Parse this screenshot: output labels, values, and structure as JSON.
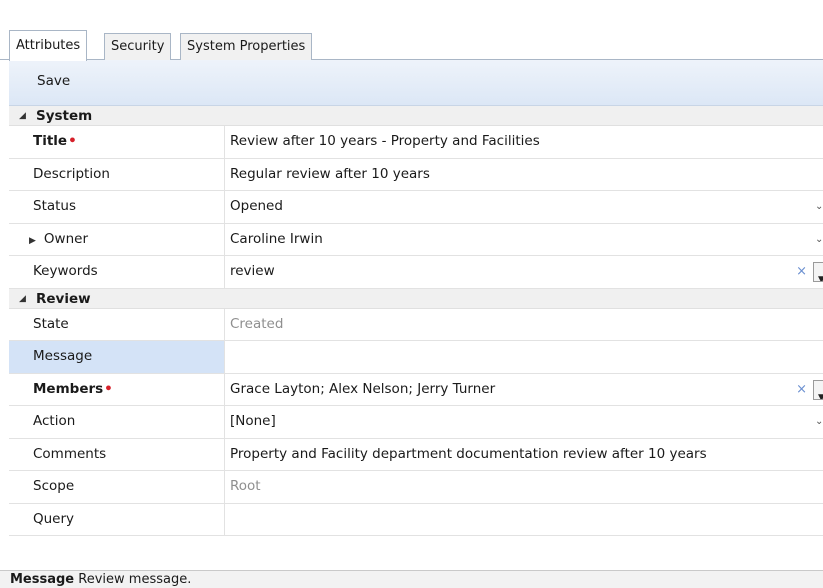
{
  "tabs": [
    "Attributes",
    "Security",
    "System Properties"
  ],
  "toolbar": {
    "save_label": "Save"
  },
  "groups": {
    "system": "System",
    "review": "Review"
  },
  "fields": {
    "title": {
      "label": "Title",
      "value": "Review after 10 years - Property and Facilities"
    },
    "description": {
      "label": "Description",
      "value": "Regular review after 10 years"
    },
    "status": {
      "label": "Status",
      "value": "Opened"
    },
    "owner": {
      "label": "Owner",
      "value": "Caroline Irwin"
    },
    "keywords": {
      "label": "Keywords",
      "value": "review"
    },
    "state": {
      "label": "State",
      "value": "Created"
    },
    "message": {
      "label": "Message",
      "value": ""
    },
    "members": {
      "label": "Members",
      "value": "Grace Layton; Alex Nelson; Jerry Turner"
    },
    "action": {
      "label": "Action",
      "value": "[None]"
    },
    "comments": {
      "label": "Comments",
      "value": "Property and Facility department documentation review after 10 years"
    },
    "scope": {
      "label": "Scope",
      "value": "Root"
    },
    "query": {
      "label": "Query",
      "value": ""
    }
  },
  "statusbar": {
    "name": "Message",
    "text": "Review message."
  },
  "icons": {
    "collapse": "triangle-collapse-icon",
    "expand": "triangle-expand-icon",
    "dropdown": "chevron-down-icon",
    "clear": "clear-x-icon"
  },
  "colors": {
    "required": "#d6202a",
    "selected_row": "#d4e3f7",
    "toolbar": "#dce7f6"
  }
}
